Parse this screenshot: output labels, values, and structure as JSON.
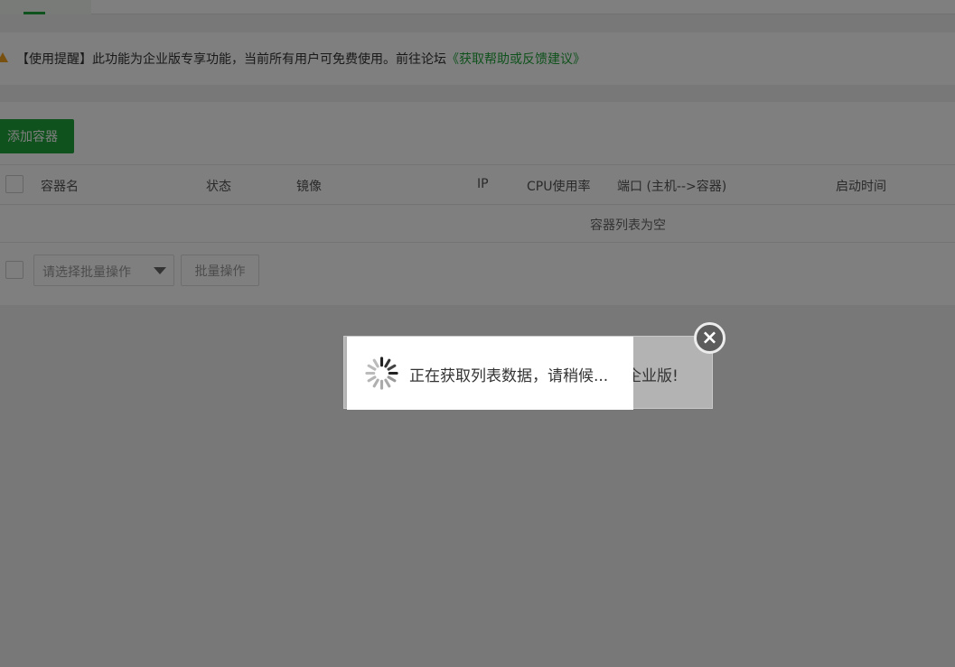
{
  "notice": {
    "prefix": "【使用提醒】此功能为企业版专享功能，当前所有用户可免费使用。前往论坛",
    "link": "《获取帮助或反馈建议》"
  },
  "toolbar": {
    "add_label": "添加容器"
  },
  "table": {
    "columns": [
      "容器名",
      "状态",
      "镜像",
      "IP",
      "CPU使用率",
      "端口 (主机-->容器)",
      "启动时间"
    ],
    "empty_text": "容器列表为空"
  },
  "batch": {
    "select_placeholder": "请选择批量操作",
    "button_label": "批量操作"
  },
  "background_dialog": {
    "text": "企业版!"
  },
  "loading": {
    "text": "正在获取列表数据，请稍候..."
  },
  "colors": {
    "accent": "#20a53a",
    "warning": "#f0a020"
  }
}
